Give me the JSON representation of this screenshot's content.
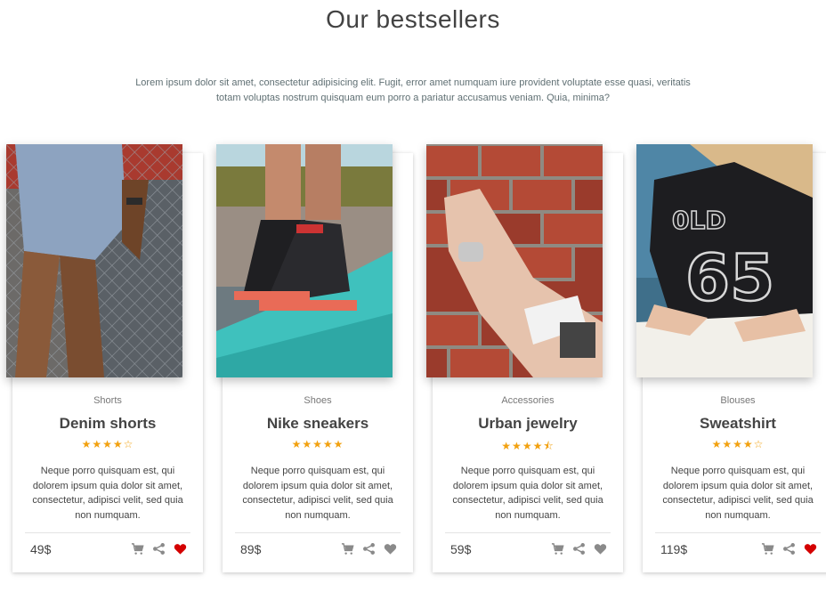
{
  "section": {
    "title": "Our bestsellers",
    "intro_line1": "Lorem ipsum dolor sit amet, consectetur adipisicing elit. Fugit, error amet numquam iure provident voluptate esse quasi, veritatis",
    "intro_line2": "totam voluptas nostrum quisquam eum porro a pariatur accusamus veniam. Quia, minima?"
  },
  "colors": {
    "star": "#f2a10f",
    "heart_active": "#d40000",
    "icon_gray": "#8a8a8a"
  },
  "products": [
    {
      "category": "Shorts",
      "name": "Denim shorts",
      "stars": "★★★★☆",
      "rating": 4,
      "description": "Neque porro quisquam est, qui dolorem ipsum quia dolor sit amet, consectetur, adipisci velit, sed quia non numquam.",
      "price": "49$",
      "favorited": true,
      "icons": [
        "cart-icon",
        "share-icon",
        "heart-icon"
      ]
    },
    {
      "category": "Shoes",
      "name": "Nike sneakers",
      "stars": "★★★★★",
      "rating": 5,
      "description": "Neque porro quisquam est, qui dolorem ipsum quia dolor sit amet, consectetur, adipisci velit, sed quia non numquam.",
      "price": "89$",
      "favorited": false,
      "icons": [
        "cart-icon",
        "share-icon",
        "heart-icon"
      ]
    },
    {
      "category": "Accessories",
      "name": "Urban jewelry",
      "stars": "★★★★⯪",
      "rating": 4.5,
      "description": "Neque porro quisquam est, qui dolorem ipsum quia dolor sit amet, consectetur, adipisci velit, sed quia non numquam.",
      "price": "59$",
      "favorited": false,
      "icons": [
        "cart-icon",
        "share-icon",
        "heart-icon"
      ]
    },
    {
      "category": "Blouses",
      "name": "Sweatshirt",
      "stars": "★★★★☆",
      "rating": 4,
      "description": "Neque porro quisquam est, qui dolorem ipsum quia dolor sit amet, consectetur, adipisci velit, sed quia non numquam.",
      "price": "119$",
      "favorited": true,
      "icons": [
        "cart-icon",
        "share-icon",
        "heart-icon"
      ]
    }
  ]
}
